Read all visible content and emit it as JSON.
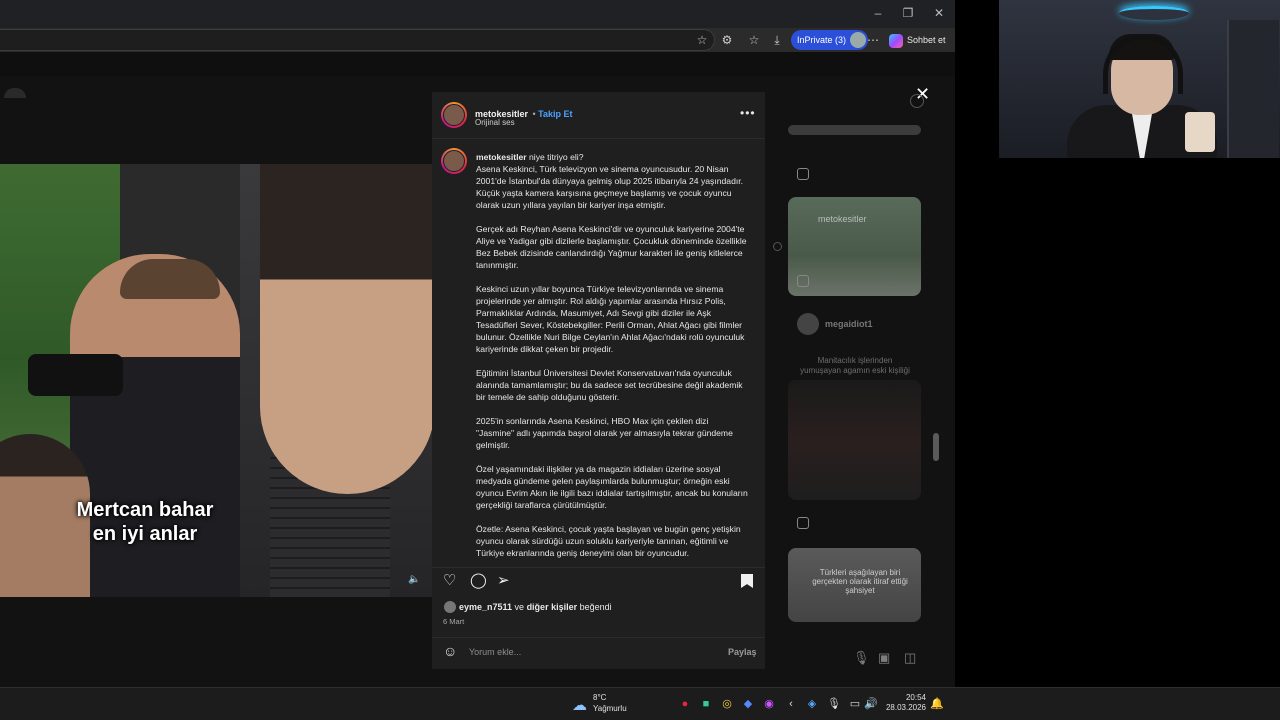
{
  "browser": {
    "inprivate_label": "InPrivate (3)",
    "chat_label": "Sohbet et",
    "minimize": "–",
    "maximize": "❐",
    "close": "✕"
  },
  "video": {
    "caption_line1": "Mertcan bahar",
    "caption_line2": "en iyi anlar"
  },
  "post": {
    "username": "metokesitler",
    "follow_label": "Takip Et",
    "audio": "Orijinal ses",
    "caption_title": "niye titriyo eli?",
    "paragraphs": [
      "Asena Keskinci, Türk televizyon ve sinema oyuncusudur. 20 Nisan 2001'de İstanbul'da dünyaya gelmiş olup 2025 itibarıyla 24 yaşındadır. Küçük yaşta kamera karşısına geçmeye başlamış ve çocuk oyuncu olarak uzun yıllara yayılan bir kariyer inşa etmiştir.",
      "Gerçek adı Reyhan Asena Keskinci'dir ve oyunculuk kariyerine 2004'te Aliye ve Yadigar gibi dizilerle başlamıştır. Çocukluk döneminde özellikle Bez Bebek dizisinde canlandırdığı Yağmur karakteri ile geniş kitlelerce tanınmıştır.",
      "Keskinci uzun yıllar boyunca Türkiye televizyonlarında ve sinema projelerinde yer almıştır. Rol aldığı yapımlar arasında Hırsız Polis, Parmaklıklar Ardında, Masumiyet, Adı Sevgi gibi diziler ile Aşk Tesadüfleri Sever, Köstebekgiller: Perili Orman, Ahlat Ağacı gibi filmler bulunur. Özellikle Nuri Bilge Ceylan'ın Ahlat Ağacı'ndaki rolü oyunculuk kariyerinde dikkat çeken bir projedir.",
      "Eğitimini İstanbul Üniversitesi Devlet Konservatuvarı'nda oyunculuk alanında tamamlamıştır; bu da sadece set tecrübesine değil akademik bir temele de sahip olduğunu gösterir.",
      "2025'in sonlarında Asena Keskinci, HBO Max için çekilen dizi \"Jasmine\" adlı yapımda başrol olarak yer almasıyla tekrar gündeme gelmiştir.",
      "Özel yaşamındaki ilişkiler ya da magazin iddiaları üzerine sosyal medyada gündeme gelen paylaşımlarda bulunmuştur; örneğin eski oyuncu Evrim Akın ile ilgili bazı iddialar tartışılmıştır, ancak bu konuların gerçekliği taraflarca çürütülmüştür.",
      "Özetle: Asena Keskinci, çocuk yaşta başlayan ve bugün genç yetişkin oyuncu olarak sürdüğü uzun soluklu kariyeriyle tanınan, eğitimli ve Türkiye ekranlarında geniş deneyimi olan bir oyuncudur."
    ],
    "likes_user": "eyme_n7511",
    "likes_mid": " ve ",
    "likes_others": "diğer kişiler",
    "likes_suffix": " beğendi",
    "date": "6 Mart",
    "comment_placeholder": "Yorum ekle...",
    "share_label": "Paylaş"
  },
  "feed": {
    "thumb1_text": "metokesitler",
    "user2": "megaidiot1",
    "text2_line1": "Manitacılık işlerinden",
    "text2_line2": "yumuşayan agamın eski kişiliği",
    "text3": "Türkleri aşağılayan biri gerçekten olarak itiraf ettiği şahsiyet"
  },
  "taskbar": {
    "temperature": "8°C",
    "weather": "Yağmurlu",
    "time": "20:54",
    "date": "28.03.2026"
  }
}
